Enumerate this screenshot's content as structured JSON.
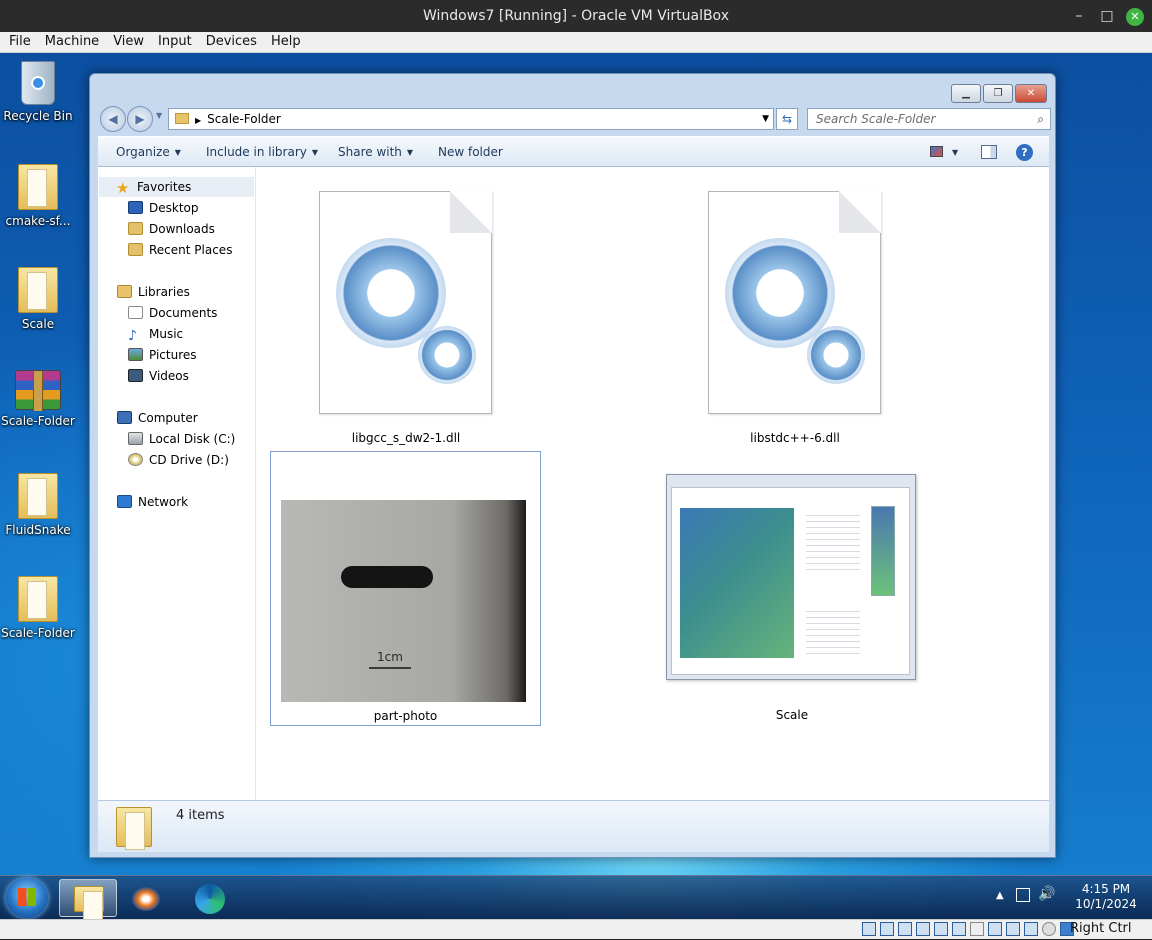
{
  "host_window": {
    "title": "Windows7 [Running] - Oracle VM VirtualBox",
    "menu": [
      "File",
      "Machine",
      "View",
      "Input",
      "Devices",
      "Help"
    ],
    "controls": {
      "minimize": "–",
      "maximize": "□",
      "close": "✕"
    }
  },
  "desktop": {
    "icons": [
      {
        "label": "Recycle Bin",
        "icon": "recycle-bin-icon"
      },
      {
        "label": "cmake-sf...",
        "icon": "folder-icon"
      },
      {
        "label": "Scale",
        "icon": "folder-icon"
      },
      {
        "label": "Scale-Folder",
        "icon": "winrar-archive-icon"
      },
      {
        "label": "FluidSnake",
        "icon": "folder-icon"
      },
      {
        "label": "Scale-Folder",
        "icon": "folder-icon"
      }
    ]
  },
  "explorer": {
    "address": {
      "path": "Scale-Folder"
    },
    "search": {
      "placeholder": "Search Scale-Folder"
    },
    "commands": [
      "Organize",
      "Include in library",
      "Share with",
      "New folder"
    ],
    "nav": {
      "favorites": {
        "label": "Favorites",
        "items": [
          "Desktop",
          "Downloads",
          "Recent Places"
        ]
      },
      "libraries": {
        "label": "Libraries",
        "items": [
          "Documents",
          "Music",
          "Pictures",
          "Videos"
        ]
      },
      "computer": {
        "label": "Computer",
        "items": [
          "Local Disk (C:)",
          "CD Drive (D:)"
        ]
      },
      "network": {
        "label": "Network"
      }
    },
    "files": [
      {
        "name": "libgcc_s_dw2-1.dll",
        "type": "dll",
        "selected": false
      },
      {
        "name": "libstdc++-6.dll",
        "type": "dll",
        "selected": false
      },
      {
        "name": "part-photo",
        "type": "image",
        "selected": true,
        "photo_caption": "1cm"
      },
      {
        "name": "Scale",
        "type": "application",
        "selected": false
      }
    ],
    "status": {
      "item_count": "4 items"
    }
  },
  "taskbar": {
    "apps": [
      "start-orb",
      "windows-explorer",
      "media-player",
      "edge"
    ],
    "clock": {
      "time": "4:15 PM",
      "date": "10/1/2024"
    }
  },
  "vbox_status": {
    "host_key": "Right Ctrl"
  },
  "colors": {
    "selection": "#cce4f7",
    "selection_border": "#7da2ce",
    "link": "#1e395b"
  }
}
